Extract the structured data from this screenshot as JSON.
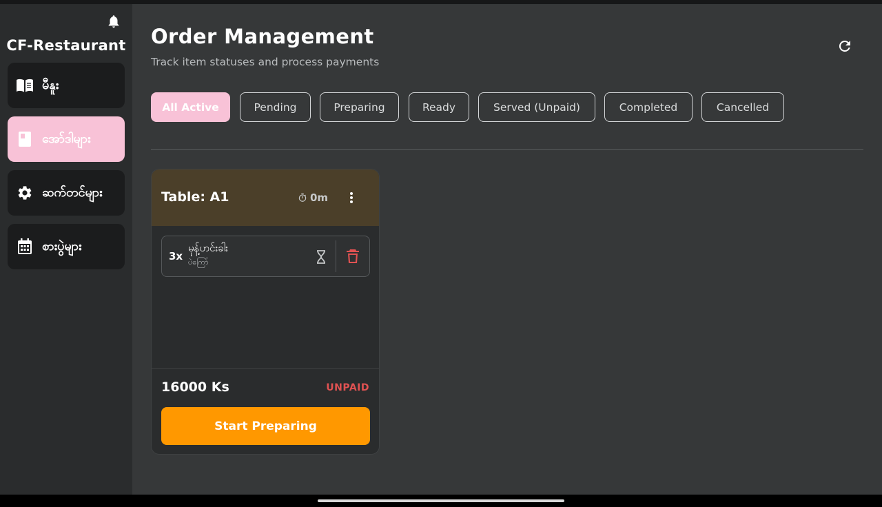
{
  "app": {
    "name": "CF-Restaurant"
  },
  "sidebar": {
    "items": [
      {
        "label": "မီနူး",
        "icon": "menu-book-icon",
        "active": false
      },
      {
        "label": "အော်ဒါများ",
        "icon": "receipt-icon",
        "active": true
      },
      {
        "label": "ဆက်တင်များ",
        "icon": "gear-icon",
        "active": false
      },
      {
        "label": "စားပွဲများ",
        "icon": "calendar-icon",
        "active": false
      }
    ]
  },
  "header": {
    "title": "Order Management",
    "subtitle": "Track item statuses and process payments"
  },
  "filters": {
    "items": [
      {
        "label": "All Active",
        "active": true
      },
      {
        "label": "Pending",
        "active": false
      },
      {
        "label": "Preparing",
        "active": false
      },
      {
        "label": "Ready",
        "active": false
      },
      {
        "label": "Served (Unpaid)",
        "active": false
      },
      {
        "label": "Completed",
        "active": false
      },
      {
        "label": "Cancelled",
        "active": false
      }
    ]
  },
  "orders": [
    {
      "table": "Table: A1",
      "elapsed": "0m",
      "items": [
        {
          "qty": "3x",
          "name": "မုန့်ဟင်းခါး",
          "note": "ပဲကြော်",
          "status_icon": "hourglass-icon"
        }
      ],
      "total": "16000 Ks",
      "payment_status": "UNPAID",
      "action_label": "Start Preparing"
    }
  ],
  "colors": {
    "accent_pink": "#f8c2d7",
    "action_orange": "#ff9800",
    "unpaid_red": "#e05252",
    "card_header": "#4b3f29"
  }
}
